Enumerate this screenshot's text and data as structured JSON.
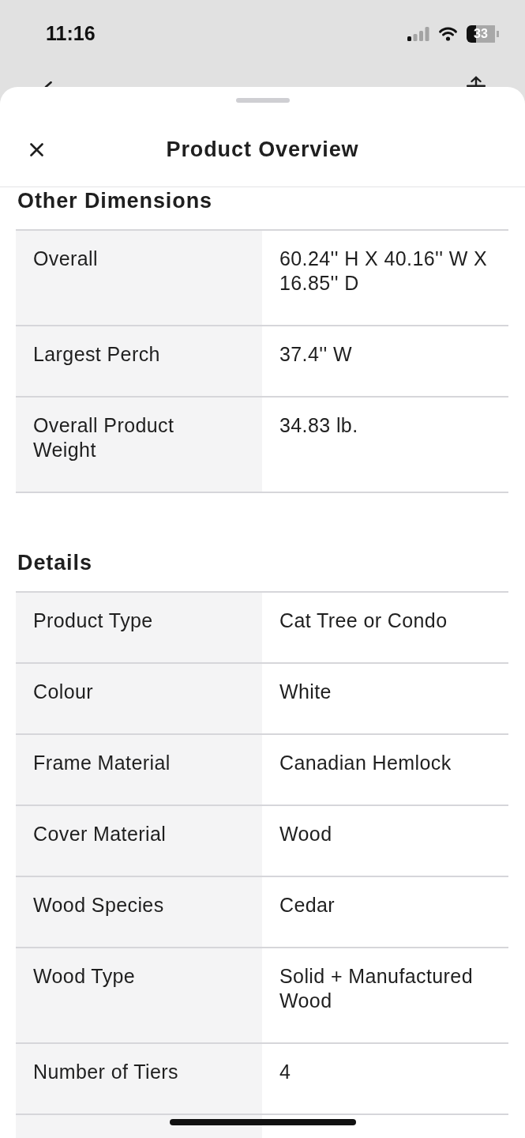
{
  "status_bar": {
    "time": "11:16",
    "battery": "33"
  },
  "sheet": {
    "title": "Product Overview"
  },
  "sections": [
    {
      "heading": "Other Dimensions",
      "rows": [
        {
          "label": "Overall",
          "value": "60.24'' H X 40.16'' W X 16.85'' D"
        },
        {
          "label": "Largest Perch",
          "value": "37.4'' W"
        },
        {
          "label": "Overall Product Weight",
          "value": "34.83 lb."
        }
      ]
    },
    {
      "heading": "Details",
      "rows": [
        {
          "label": "Product Type",
          "value": "Cat Tree or Condo"
        },
        {
          "label": "Colour",
          "value": "White"
        },
        {
          "label": "Frame Material",
          "value": "Canadian Hemlock"
        },
        {
          "label": "Cover Material",
          "value": "Wood"
        },
        {
          "label": "Wood Species",
          "value": "Cedar"
        },
        {
          "label": "Wood Type",
          "value": "Solid + Manufactured Wood"
        },
        {
          "label": "Number of Tiers",
          "value": "4"
        }
      ]
    }
  ]
}
